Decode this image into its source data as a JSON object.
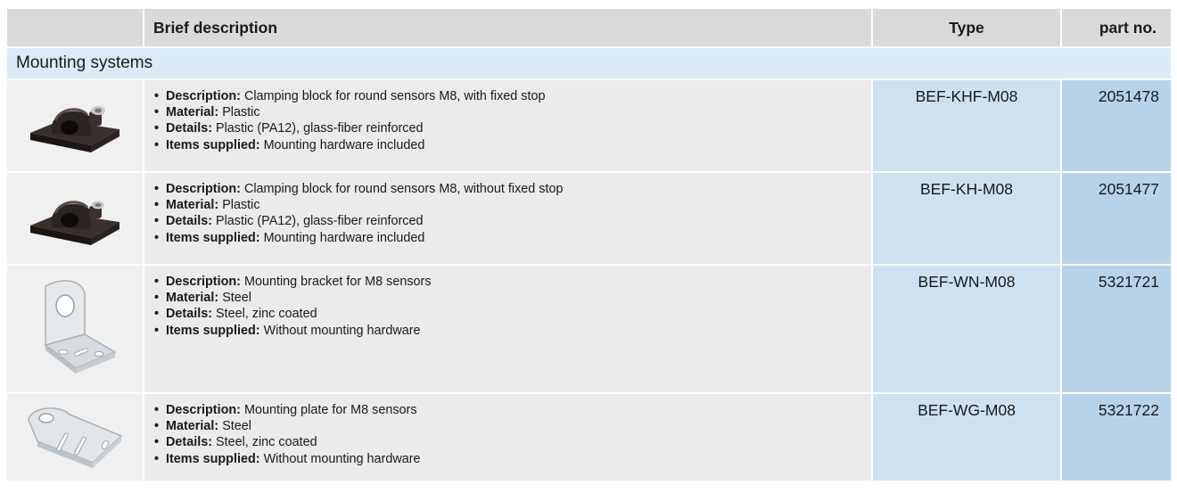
{
  "header": {
    "description": "Brief description",
    "type": "Type",
    "part_no": "part no."
  },
  "section_title": "Mounting systems",
  "labels": {
    "description": "Description:",
    "material": "Material:",
    "details": "Details:",
    "items_supplied": "Items supplied:"
  },
  "rows": [
    {
      "image_icon": "clamping-block-icon",
      "description": "Clamping block for round sensors M8, with fixed stop",
      "material": "Plastic",
      "details": "Plastic (PA12), glass-fiber reinforced",
      "items_supplied": "Mounting hardware included",
      "type": "BEF-KHF-M08",
      "part_no": "2051478"
    },
    {
      "image_icon": "clamping-block-icon",
      "description": "Clamping block for round sensors M8, without fixed stop",
      "material": "Plastic",
      "details": "Plastic (PA12), glass-fiber reinforced",
      "items_supplied": "Mounting hardware included",
      "type": "BEF-KH-M08",
      "part_no": "2051477"
    },
    {
      "image_icon": "mounting-bracket-icon",
      "description": "Mounting bracket for M8 sensors",
      "material": "Steel",
      "details": "Steel, zinc coated",
      "items_supplied": "Without mounting hardware",
      "type": "BEF-WN-M08",
      "part_no": "5321721"
    },
    {
      "image_icon": "mounting-plate-icon",
      "description": "Mounting plate for M8 sensors",
      "material": "Steel",
      "details": "Steel, zinc coated",
      "items_supplied": "Without mounting hardware",
      "type": "BEF-WG-M08",
      "part_no": "5321722"
    }
  ]
}
